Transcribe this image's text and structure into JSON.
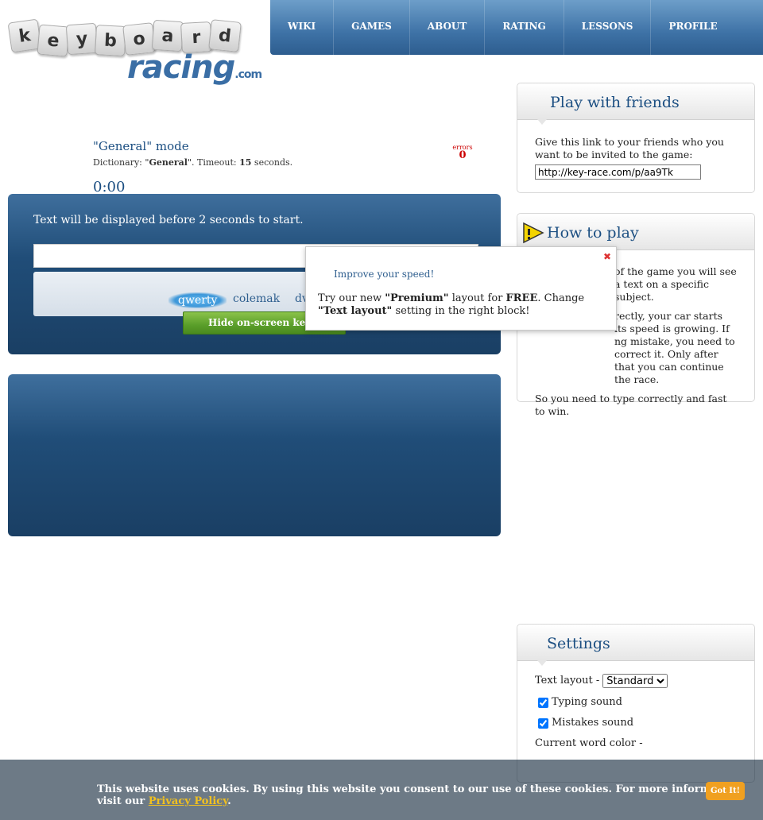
{
  "logo": {
    "keys": [
      "k",
      "e",
      "y",
      "b",
      "o",
      "a",
      "r",
      "d"
    ],
    "racing": "racing",
    "dotcom": ".com"
  },
  "nav": [
    "WIKI",
    "GAMES",
    "ABOUT",
    "RATING",
    "LESSONS",
    "PROFILE"
  ],
  "game": {
    "mode_title": "\"General\" mode",
    "dict_prefix": "Dictionary: \"",
    "dict_name": "General",
    "dict_mid": "\". Timeout: ",
    "timeout": "15",
    "dict_suffix": " seconds.",
    "errors_label": "errors",
    "errors_value": "0",
    "timer": "0:00"
  },
  "race": {
    "start_text": "Text will be displayed before 2 seconds to start.",
    "layouts": [
      "qwerty",
      "colemak",
      "dv"
    ],
    "active_layout": "qwerty",
    "hide_keyboard": "Hide on-screen keybo"
  },
  "popup": {
    "title": "Improve your speed!",
    "body_1": "Try our new ",
    "body_premium": "\"Premium\"",
    "body_2": " layout for ",
    "body_free": "FREE",
    "body_3": ". Change ",
    "body_text_layout": "\"Text layout\"",
    "body_4": " setting in the right block!",
    "close": "✖"
  },
  "friends": {
    "title": "Play with friends",
    "text": "Give this link to your friends who you want to be invited to the game:",
    "link": "http://key-race.com/p/aa9Tk"
  },
  "howto": {
    "title": "How to play",
    "p1": "of the game you will see a text on a specific subject.",
    "p2": "rectly, your car starts its speed is growing. If ng mistake, you need to correct it. Only after that you can continue the race.",
    "p3": "So you need to type correctly and fast to win."
  },
  "settings": {
    "title": "Settings",
    "text_layout_label": "Text layout -",
    "text_layout_value": "Standard",
    "typing_sound": "Typing sound",
    "mistakes_sound": "Mistakes sound",
    "current_word_color": "Current word color -"
  },
  "cookie": {
    "text": "This website uses cookies. By using this website you consent to our use of these cookies. For more information visit our ",
    "link": "Privacy Policy",
    "after": ".",
    "button": "Got It!"
  },
  "colors": {
    "nav_blue": "#3e72a6",
    "title_blue": "#1c4f82",
    "error_red": "#cc0000",
    "button_green": "#5a9e2a",
    "cookie_button": "#f0a020"
  }
}
